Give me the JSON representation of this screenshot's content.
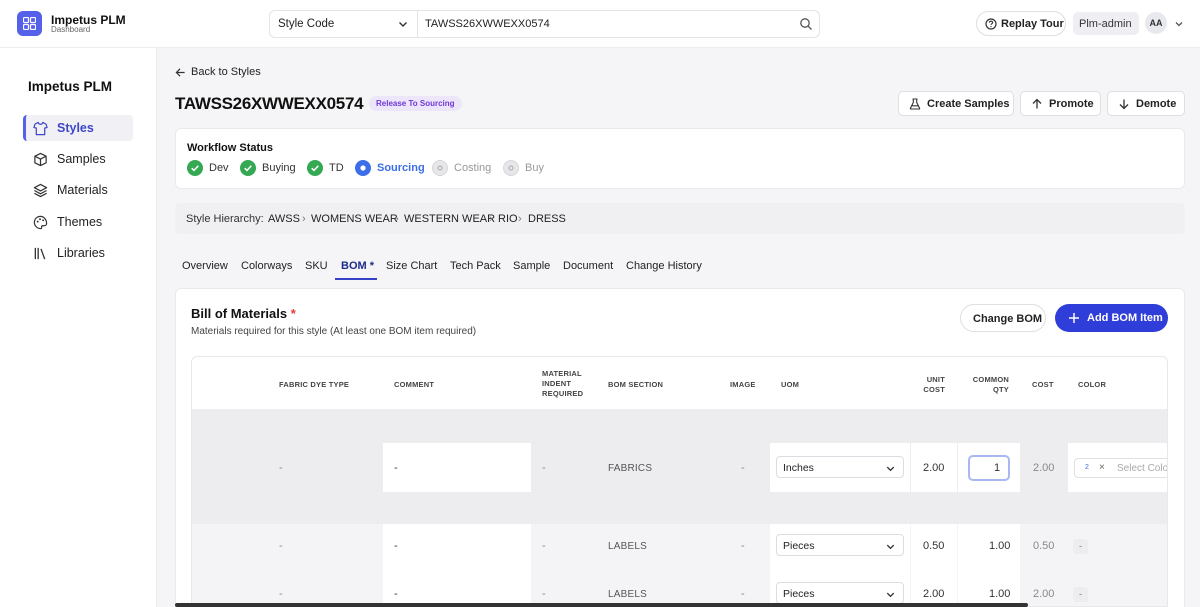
{
  "app": {
    "name": "Impetus PLM",
    "subtitle": "Dashboard"
  },
  "search": {
    "type": "Style Code",
    "value": "TAWSS26XWWEXX0574"
  },
  "header": {
    "tour": "Replay Tour",
    "user": "Plm-admin",
    "avatar": "AA"
  },
  "sidebar": {
    "title": "Impetus PLM",
    "items": [
      {
        "label": "Styles"
      },
      {
        "label": "Samples"
      },
      {
        "label": "Materials"
      },
      {
        "label": "Themes"
      },
      {
        "label": "Libraries"
      }
    ]
  },
  "page": {
    "back": "Back to Styles",
    "title": "TAWSS26XWWEXX0574",
    "stage": "Release To Sourcing",
    "actions": {
      "create": "Create Samples",
      "promote": "Promote",
      "demote": "Demote"
    }
  },
  "workflow": {
    "title": "Workflow Status",
    "steps": [
      {
        "label": "Dev",
        "state": "done"
      },
      {
        "label": "Buying",
        "state": "done"
      },
      {
        "label": "TD",
        "state": "done"
      },
      {
        "label": "Sourcing",
        "state": "current"
      },
      {
        "label": "Costing",
        "state": "pending"
      },
      {
        "label": "Buy",
        "state": "pending"
      }
    ]
  },
  "hierarchy": {
    "label": "Style Hierarchy:",
    "items": [
      "AWSS",
      "WOMENS WEAR",
      "WESTERN WEAR",
      "RIO",
      "DRESS"
    ],
    "separator": "›"
  },
  "tabs": [
    "Overview",
    "Colorways",
    "SKU",
    "BOM *",
    "Size Chart",
    "Tech Pack",
    "Sample",
    "Document",
    "Change History"
  ],
  "bom": {
    "title": "Bill of Materials",
    "required_mark": "*",
    "subtitle": "Materials required for this style (At least one BOM item required)",
    "change_btn": "Change BOM",
    "add_btn": "Add BOM Item",
    "columns": {
      "fabric_dye": "FABRIC DYE TYPE",
      "comment": "COMMENT",
      "indent_1": "MATERIAL",
      "indent_2": "INDENT",
      "indent_3": "REQUIRED",
      "section": "BOM SECTION",
      "image": "IMAGE",
      "uom": "UOM",
      "unit_1": "UNIT",
      "unit_2": "COST",
      "qty_1": "COMMON",
      "qty_2": "QTY",
      "cost": "COST",
      "color": "COLOR"
    },
    "rows": [
      {
        "fabric_dye": "-",
        "comment": "-",
        "indent": "-",
        "section": "FABRICS",
        "image": "-",
        "uom": "Inches",
        "unit_cost": "2.00",
        "qty": "1",
        "cost": "2.00",
        "color_tag": "2",
        "color_remove": "×",
        "color_placeholder": "Select Color"
      },
      {
        "fabric_dye": "-",
        "comment": "-",
        "indent": "-",
        "section": "LABELS",
        "image": "-",
        "uom": "Pieces",
        "unit_cost": "0.50",
        "qty": "1.00",
        "cost": "0.50",
        "color": "-"
      },
      {
        "fabric_dye": "-",
        "comment": "-",
        "indent": "-",
        "section": "LABELS",
        "image": "-",
        "uom": "Pieces",
        "unit_cost": "2.00",
        "qty": "1.00",
        "cost": "2.00",
        "color": "-"
      }
    ]
  }
}
